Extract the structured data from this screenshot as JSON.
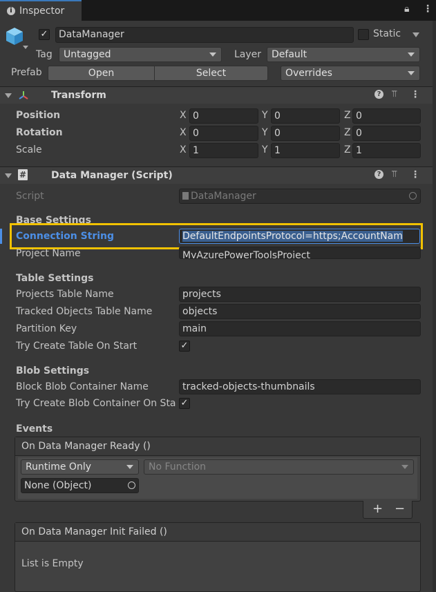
{
  "window": {
    "tab_title": "Inspector"
  },
  "object": {
    "name": "DataManager",
    "active": true,
    "static_label": "Static",
    "static_checked": false,
    "tag_label": "Tag",
    "tag_value": "Untagged",
    "layer_label": "Layer",
    "layer_value": "Default",
    "prefab_label": "Prefab",
    "prefab_open": "Open",
    "prefab_select": "Select",
    "prefab_overrides": "Overrides"
  },
  "transform": {
    "title": "Transform",
    "rows": [
      {
        "label": "Position",
        "x": "0",
        "y": "0",
        "z": "0"
      },
      {
        "label": "Rotation",
        "x": "0",
        "y": "0",
        "z": "0"
      },
      {
        "label": "Scale",
        "x": "1",
        "y": "1",
        "z": "1"
      }
    ],
    "axis_x": "X",
    "axis_y": "Y",
    "axis_z": "Z"
  },
  "script_component": {
    "title": "Data Manager (Script)",
    "script_label": "Script",
    "script_value": "DataManager",
    "base_settings": "Base Settings",
    "connection_string_label": "Connection String",
    "connection_string_value": "DefaultEndpointsProtocol=https;AccountNam",
    "project_name_label": "Project Name",
    "project_name_value": "MyAzurePowerToolsProject",
    "table_settings": "Table Settings",
    "projects_table_label": "Projects Table Name",
    "projects_table_value": "projects",
    "tracked_table_label": "Tracked Objects Table Name",
    "tracked_table_value": "objects",
    "partition_key_label": "Partition Key",
    "partition_key_value": "main",
    "try_create_table_label": "Try Create Table On Start",
    "try_create_table_checked": true,
    "blob_settings": "Blob Settings",
    "block_blob_label": "Block Blob Container Name",
    "block_blob_value": "tracked-objects-thumbnails",
    "try_create_blob_label": "Try Create Blob Container On Sta",
    "try_create_blob_checked": true,
    "events": "Events",
    "event_ready_title": "On Data Manager Ready ()",
    "runtime_value": "Runtime Only",
    "function_value": "No Function",
    "object_value": "None (Object)",
    "plus": "+",
    "minus": "−",
    "event_failed_title": "On Data Manager Init Failed ()",
    "list_empty": "List is Empty"
  },
  "colors": {
    "highlight": "#f2c200",
    "link_blue": "#4c8fe6",
    "selection": "#3a5f8f"
  }
}
